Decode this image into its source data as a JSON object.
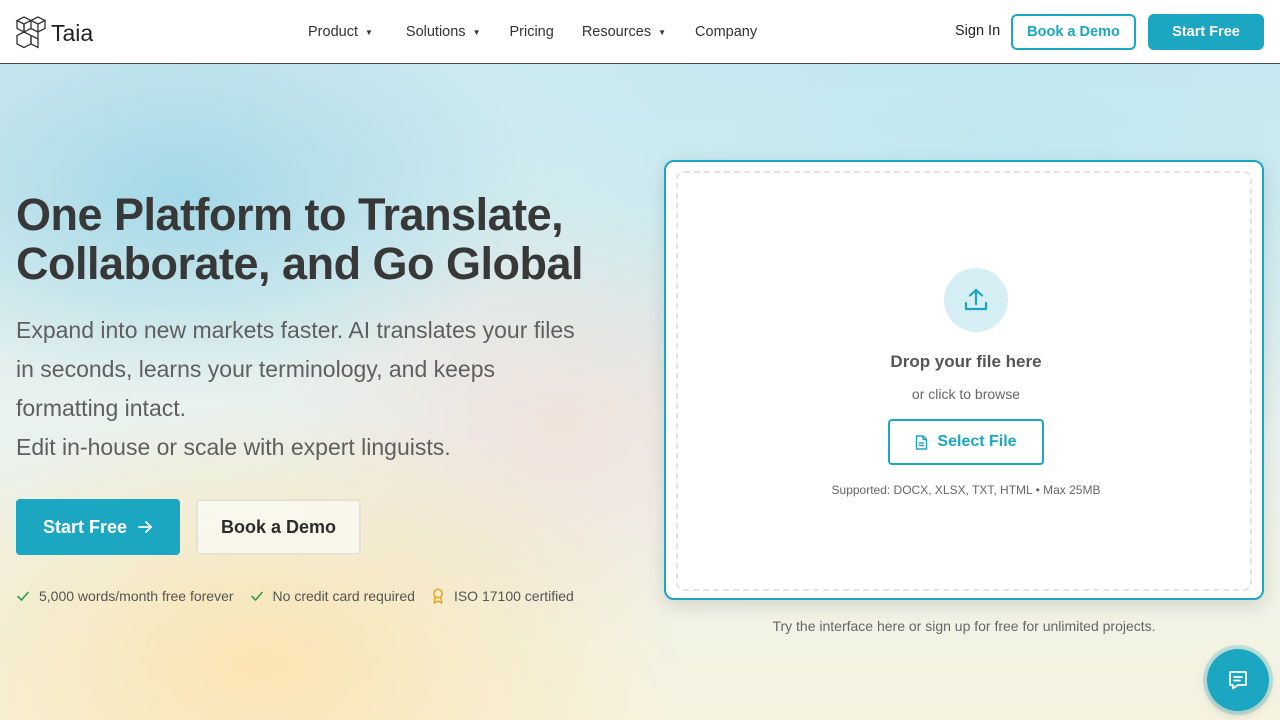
{
  "brand": {
    "name": "Taia"
  },
  "nav": {
    "items": [
      {
        "label": "Product",
        "has_dropdown": true
      },
      {
        "label": "Solutions",
        "has_dropdown": true
      },
      {
        "label": "Pricing",
        "has_dropdown": false
      },
      {
        "label": "Resources",
        "has_dropdown": true
      },
      {
        "label": "Company",
        "has_dropdown": false
      }
    ],
    "caret": "▼",
    "sign_in": "Sign In",
    "book_demo": "Book a Demo",
    "start_free": "Start Free"
  },
  "hero": {
    "title_lines": [
      "One Platform to Translate,",
      "Collaborate, and Go Global"
    ],
    "subtitle_lines": [
      "Expand into new markets faster. AI translates your files",
      "in seconds, learns your terminology, and keeps",
      "formatting intact.",
      "Edit in-house or scale with expert linguists."
    ],
    "start_free": "Start Free",
    "book_demo": "Book a Demo",
    "features": [
      {
        "icon": "check-icon",
        "text": "5,000 words/month free forever"
      },
      {
        "icon": "check-icon",
        "text": "No credit card required"
      },
      {
        "icon": "award-icon",
        "text": "ISO 17100 certified"
      }
    ]
  },
  "upload": {
    "title": "Drop your file here",
    "subtitle": "or click to browse",
    "select_button": "Select File",
    "supported": "Supported: DOCX, XLSX, TXT, HTML • Max 25MB",
    "note": "Try the interface here or sign up for free for unlimited projects."
  },
  "colors": {
    "accent": "#1ba6c1",
    "check": "#2e9e4f",
    "award": "#e3a21a"
  },
  "chat": {
    "icon": "chat-icon"
  }
}
